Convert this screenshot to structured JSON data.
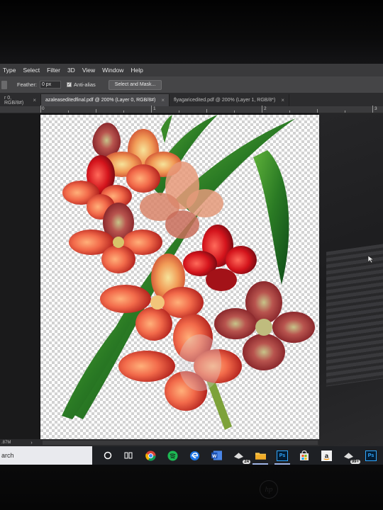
{
  "menubar": {
    "items": [
      "Type",
      "Select",
      "Filter",
      "3D",
      "View",
      "Window",
      "Help"
    ]
  },
  "options": {
    "feather_label": "Feather:",
    "feather_value": "0 px",
    "antialias_label": "Anti-alias",
    "antialias_checked": true,
    "select_mask_label": "Select and Mask..."
  },
  "tabs": [
    {
      "label": "r 0, RGB/8#)",
      "active": false
    },
    {
      "label": "azaleaseditedfinal.pdf @ 200% (Layer 0, RGB/8#)",
      "active": true
    },
    {
      "label": "flyagaricedited.pdf @ 200% (Layer 1, RGB/8*)",
      "active": false
    }
  ],
  "tab_close_glyph": "×",
  "ruler": {
    "labels": [
      "0",
      "1",
      "2",
      "3"
    ]
  },
  "status": {
    "zoom": ".87M",
    "arrow": "›"
  },
  "taskbar": {
    "search_text": "arch",
    "badges": {
      "files": "24",
      "mail": "99+"
    },
    "ps_label": "Ps"
  },
  "colors": {
    "menubar_bg": "#3a3a3c",
    "photoshop_blue": "#31a8ff",
    "taskbar_bg": "#1e2024"
  },
  "icons": [
    "task-view-icon",
    "chrome-icon",
    "spotify-icon",
    "edge-icon",
    "word-icon",
    "file-explorer-icon",
    "photoshop-icon",
    "store-icon",
    "amazon-icon"
  ],
  "artwork": {
    "subject": "gladiolus flower bouquet with transparent background"
  }
}
